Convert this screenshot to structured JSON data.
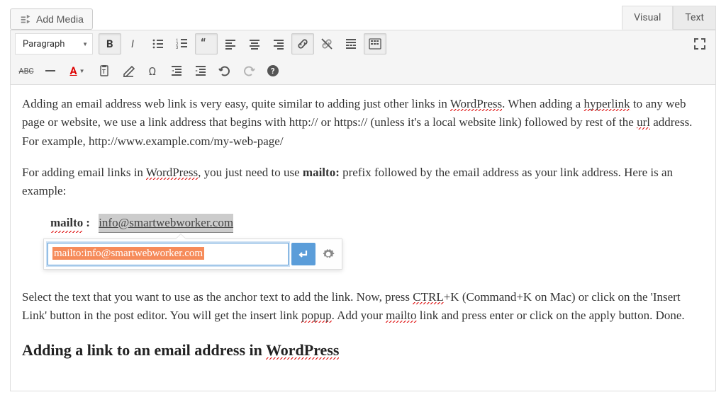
{
  "buttons": {
    "add_media": "Add Media"
  },
  "tabs": {
    "visual": "Visual",
    "text": "Text"
  },
  "toolbar": {
    "format": "Paragraph"
  },
  "content": {
    "p1_a": "Adding an email address web link is very easy, quite similar to adding just other links in ",
    "p1_wp": "WordPress",
    "p1_b": ". When adding a ",
    "p1_hy": "hyperlink",
    "p1_c": " to any web page or website, we use a link address that begins with http:// or https:// (unless it's a local website link) followed by rest of the ",
    "p1_url": "url",
    "p1_d": " address. For example, http://www.example.com/my-web-page/",
    "p2_a": "For adding email links in ",
    "p2_wp": "WordPress",
    "p2_b": ", you just need to use ",
    "p2_mailto": "mailto:",
    "p2_c": " prefix followed by the email address as your link address. Here is an example:",
    "example_prefix": "mailto",
    "example_colon": ":",
    "example_link": "info@smartwebworker.com",
    "p3_a": "Select the text that you want to use as the anchor text to add the link. Now, press ",
    "p3_ctrl": "CTRL",
    "p3_b": "+K (Command+K on Mac) or click on the 'Insert Link' button in the post editor. You will get the insert link ",
    "p3_popup": "popup",
    "p3_c": ". Add your ",
    "p3_mt": "mailto",
    "p3_d": " link and press enter or click on the apply button. Done.",
    "heading_a": "Adding a link to an email address in ",
    "heading_wp": "WordPress"
  },
  "popup": {
    "value": "mailto:info@smartwebworker.com"
  }
}
